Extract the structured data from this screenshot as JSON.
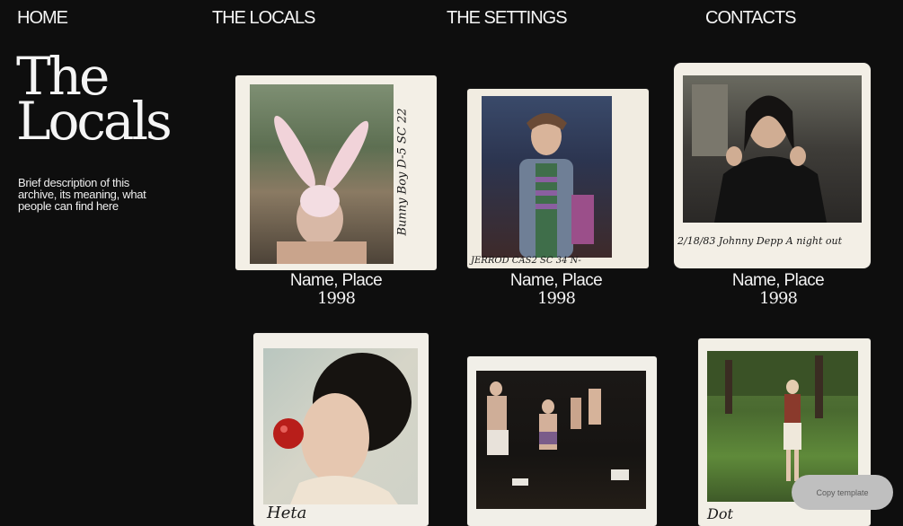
{
  "nav": {
    "home": "HOME",
    "locals": "THE LOCALS",
    "settings": "THE SETTINGS",
    "contacts": "CONTACTS"
  },
  "hero": {
    "title_line1": "The",
    "title_line2": "Locals",
    "description": "Brief description of this archive, its meaning, what people can find here"
  },
  "gallery": [
    {
      "name": "Name, Place",
      "year": "1998",
      "handwriting": "Bunny Boy  D-5  SC 22"
    },
    {
      "name": "Name, Place",
      "year": "1998",
      "handwriting": "JERROD  CAS2  SC 34  N-"
    },
    {
      "name": "Name, Place",
      "year": "1998",
      "handwriting": "2/18/83  Johnny Depp  A night out"
    },
    {
      "handwriting": "Heta"
    },
    {
      "handwriting": ""
    },
    {
      "handwriting": "Dot"
    }
  ],
  "copy_button": "Copy template",
  "colors": {
    "background": "#0e0e0e",
    "text": "#f2f2f2",
    "polaroid_frame": "#f3efe6",
    "button": "#bfbfbf"
  }
}
